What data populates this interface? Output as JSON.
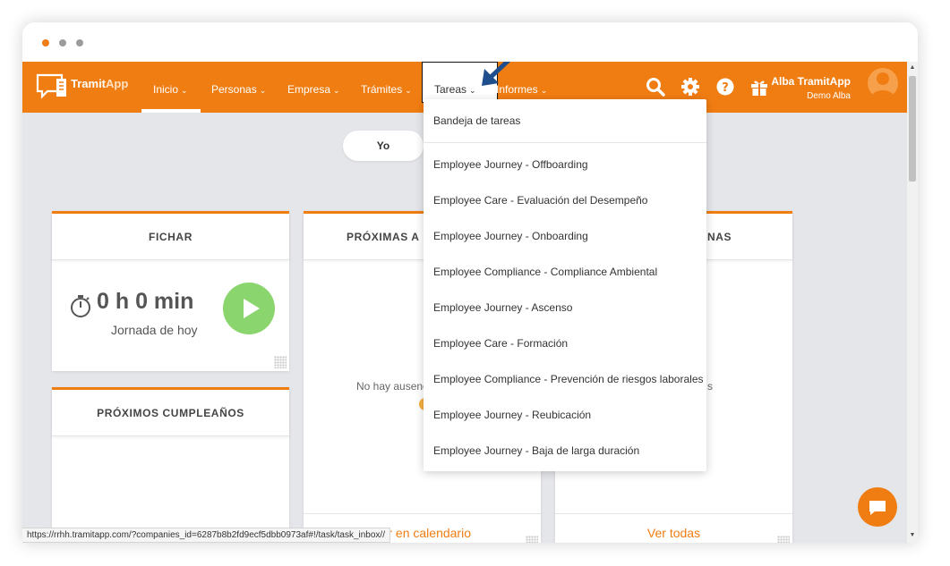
{
  "browser": {
    "traffic_lights": [
      "close",
      "minimize",
      "maximize"
    ]
  },
  "navbar": {
    "logo": {
      "part1": "Tramit",
      "part2": "App"
    },
    "items": [
      {
        "label": "Inicio",
        "active": true
      },
      {
        "label": "Personas"
      },
      {
        "label": "Empresa"
      },
      {
        "label": "Trámites"
      },
      {
        "label": "Tareas",
        "open": true
      },
      {
        "label": "Informes"
      }
    ],
    "icons": [
      "search-icon",
      "gear-icon",
      "help-icon",
      "gift-icon"
    ],
    "user": {
      "name": "Alba TramitApp",
      "company": "Demo Alba"
    }
  },
  "toggle": {
    "label": "Yo"
  },
  "cards": {
    "fichar": {
      "title": "FICHAR",
      "time": "0 h 0 min",
      "subtitle": "Jornada de hoy"
    },
    "proximas": {
      "title_visible": "PRÓXIMAS A",
      "empty_text_visible": "No hay ausenc",
      "footer": "Ver en calendario"
    },
    "third": {
      "title_visible": "NAS",
      "empty_text_visible": "s",
      "footer": "Ver todas"
    },
    "cumpleanos": {
      "title": "PRÓXIMOS CUMPLEAÑOS"
    }
  },
  "dropdown": {
    "items": [
      "Bandeja de tareas",
      "Employee Journey - Offboarding",
      "Employee Care - Evaluación del Desempeño",
      "Employee Journey - Onboarding",
      "Employee Compliance - Compliance Ambiental",
      "Employee Journey - Ascenso",
      "Employee Care - Formación",
      "Employee Compliance - Prevención de riesgos laborales",
      "Employee Journey - Reubicación",
      "Employee Journey - Baja de larga duración"
    ]
  },
  "statusbar": {
    "url": "https://rrhh.tramitapp.com/?companies_id=6287b8b2fd9ecf5dbb0973af#!/task/task_inbox//"
  },
  "colors": {
    "brand": "#f07d12",
    "play": "#8ad56d",
    "background": "#e5e6ea"
  }
}
